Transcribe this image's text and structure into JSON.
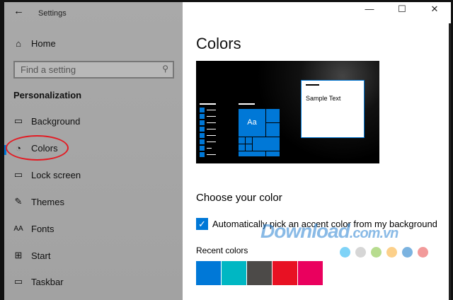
{
  "window": {
    "title": "Settings",
    "minimize": "—",
    "maximize": "☐",
    "close": "✕"
  },
  "sidebar": {
    "home": "Home",
    "search_placeholder": "Find a setting",
    "section": "Personalization",
    "items": [
      {
        "label": "Background",
        "icon": "image-icon"
      },
      {
        "label": "Colors",
        "icon": "palette-icon"
      },
      {
        "label": "Lock screen",
        "icon": "lock-screen-icon"
      },
      {
        "label": "Themes",
        "icon": "brush-icon"
      },
      {
        "label": "Fonts",
        "icon": "fonts-icon"
      },
      {
        "label": "Start",
        "icon": "start-icon"
      },
      {
        "label": "Taskbar",
        "icon": "taskbar-icon"
      }
    ]
  },
  "main": {
    "title": "Colors",
    "preview_text": "Sample Text",
    "tile_text": "Aa",
    "choose_heading": "Choose your color",
    "auto_pick_label": "Automatically pick an accent color from my background",
    "auto_pick_checked": true,
    "recent_label": "Recent colors",
    "recent_colors": [
      "#0078d7",
      "#00b7c3",
      "#4c4a48",
      "#e81123",
      "#ea005e"
    ],
    "dots": [
      "#7fd3f7",
      "#d6d6d6",
      "#b7dc8f",
      "#fcd08a",
      "#7bb3e0",
      "#f29a9a"
    ]
  },
  "watermark": "Download.com.vn",
  "accent": "#0078d7"
}
